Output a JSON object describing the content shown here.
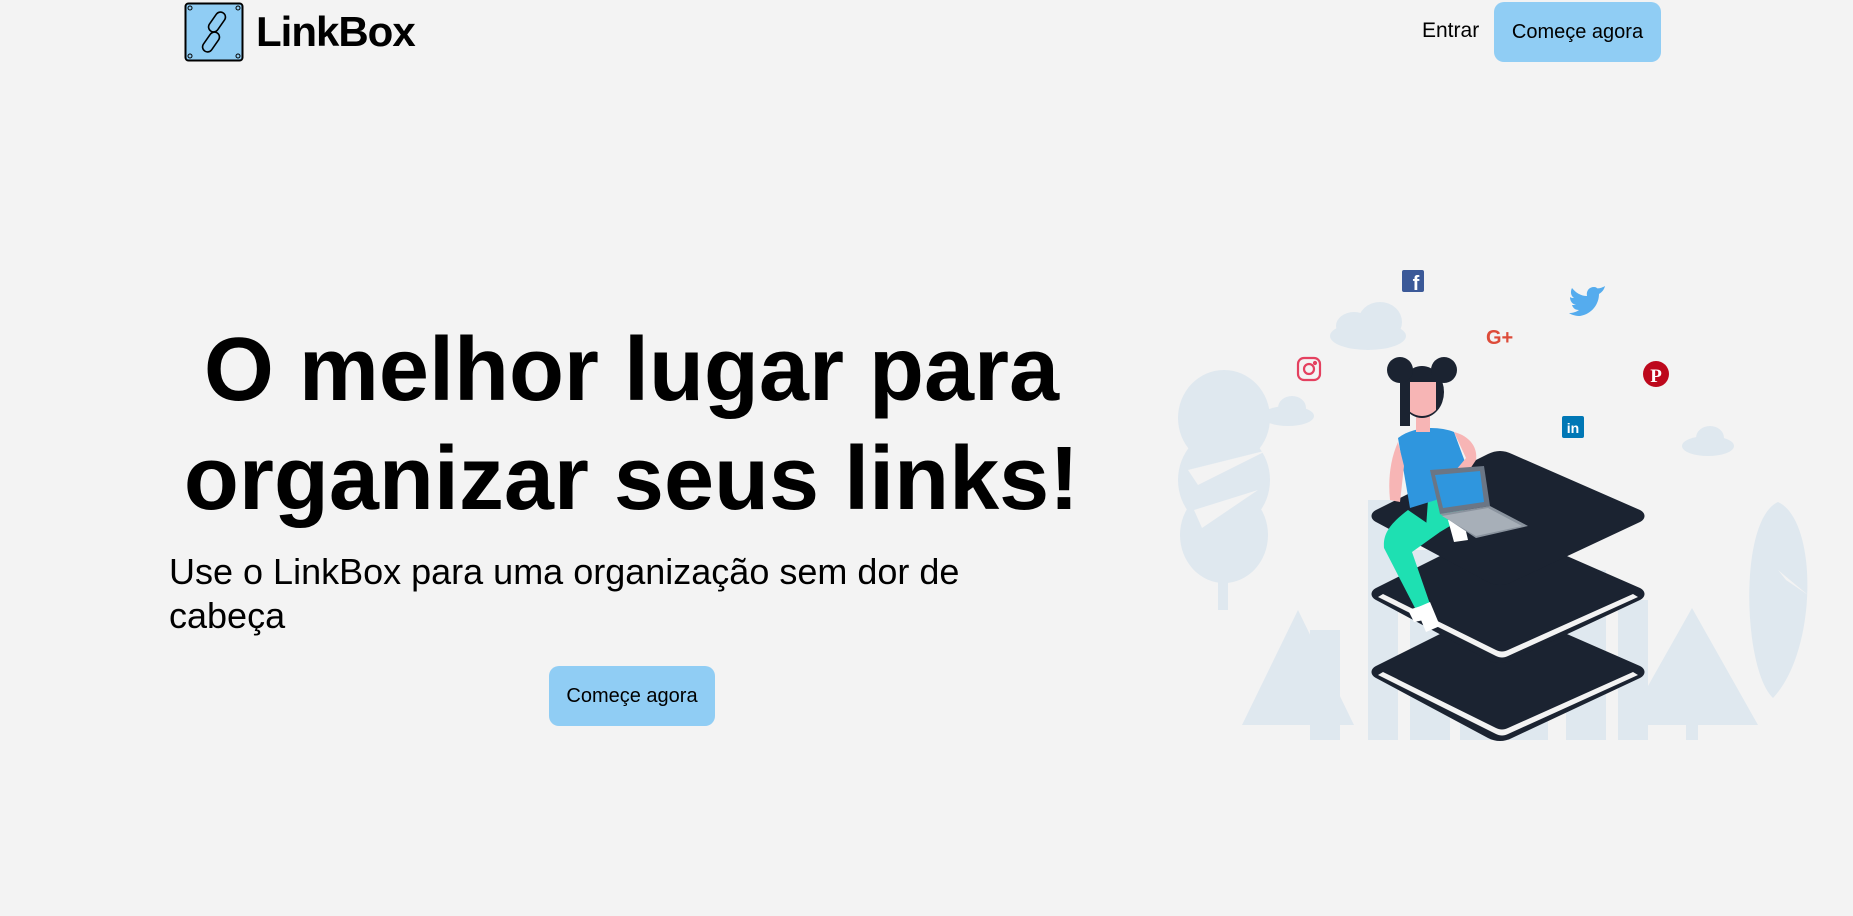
{
  "header": {
    "logo_text": "LinkBox",
    "login_label": "Entrar",
    "cta_label": "Começe agora"
  },
  "hero": {
    "title_line1": "O melhor lugar para",
    "title_line2": "organizar seus links!",
    "subtitle": "Use o LinkBox para uma organização sem dor de cabeça",
    "cta_label": "Começe agora"
  },
  "illustration": {
    "icons": [
      "facebook-icon",
      "twitter-icon",
      "google-plus-icon",
      "instagram-icon",
      "pinterest-icon",
      "linkedin-icon"
    ],
    "google_plus_text": "G+",
    "linkedin_text": "in",
    "facebook_text": "f"
  },
  "colors": {
    "background": "#f3f3f3",
    "button": "#90cdf4",
    "dark": "#1b2331",
    "shirt": "#2f96de",
    "pants": "#1ee0b2",
    "facebook": "#3b5998",
    "twitter": "#55acee",
    "google": "#dd4b39",
    "instagram": "#e4405f",
    "pinterest": "#bd081c",
    "linkedin": "#0077b5"
  }
}
